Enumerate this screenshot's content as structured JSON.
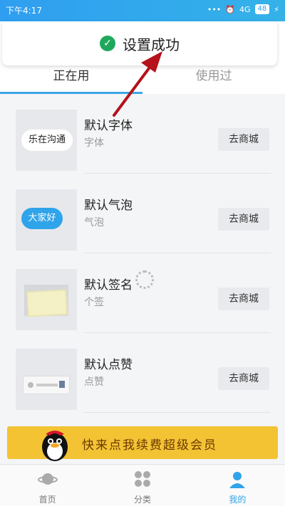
{
  "status_bar": {
    "time": "下午4:17",
    "signal": "4G",
    "battery": "48"
  },
  "toast": {
    "text": "设置成功"
  },
  "tabs": [
    {
      "label": "正在用",
      "active": true
    },
    {
      "label": "使用过",
      "active": false
    }
  ],
  "items": [
    {
      "title": "默认字体",
      "subtitle": "字体",
      "button": "去商城",
      "thumb_text": "乐在沟通"
    },
    {
      "title": "默认气泡",
      "subtitle": "气泡",
      "button": "去商城",
      "thumb_text": "大家好"
    },
    {
      "title": "默认签名",
      "subtitle": "个签",
      "button": "去商城"
    },
    {
      "title": "默认点赞",
      "subtitle": "点赞",
      "button": "去商城"
    }
  ],
  "banner": {
    "text": "快来点我续费超级会员"
  },
  "bottom_nav": [
    {
      "label": "首页",
      "icon": "planet-icon",
      "active": false
    },
    {
      "label": "分类",
      "icon": "grid-icon",
      "active": false
    },
    {
      "label": "我的",
      "icon": "user-icon",
      "active": true
    }
  ],
  "colors": {
    "accent": "#2fa4ea",
    "success": "#1fa85b",
    "banner": "#f3c334",
    "arrow": "#b5121b"
  }
}
